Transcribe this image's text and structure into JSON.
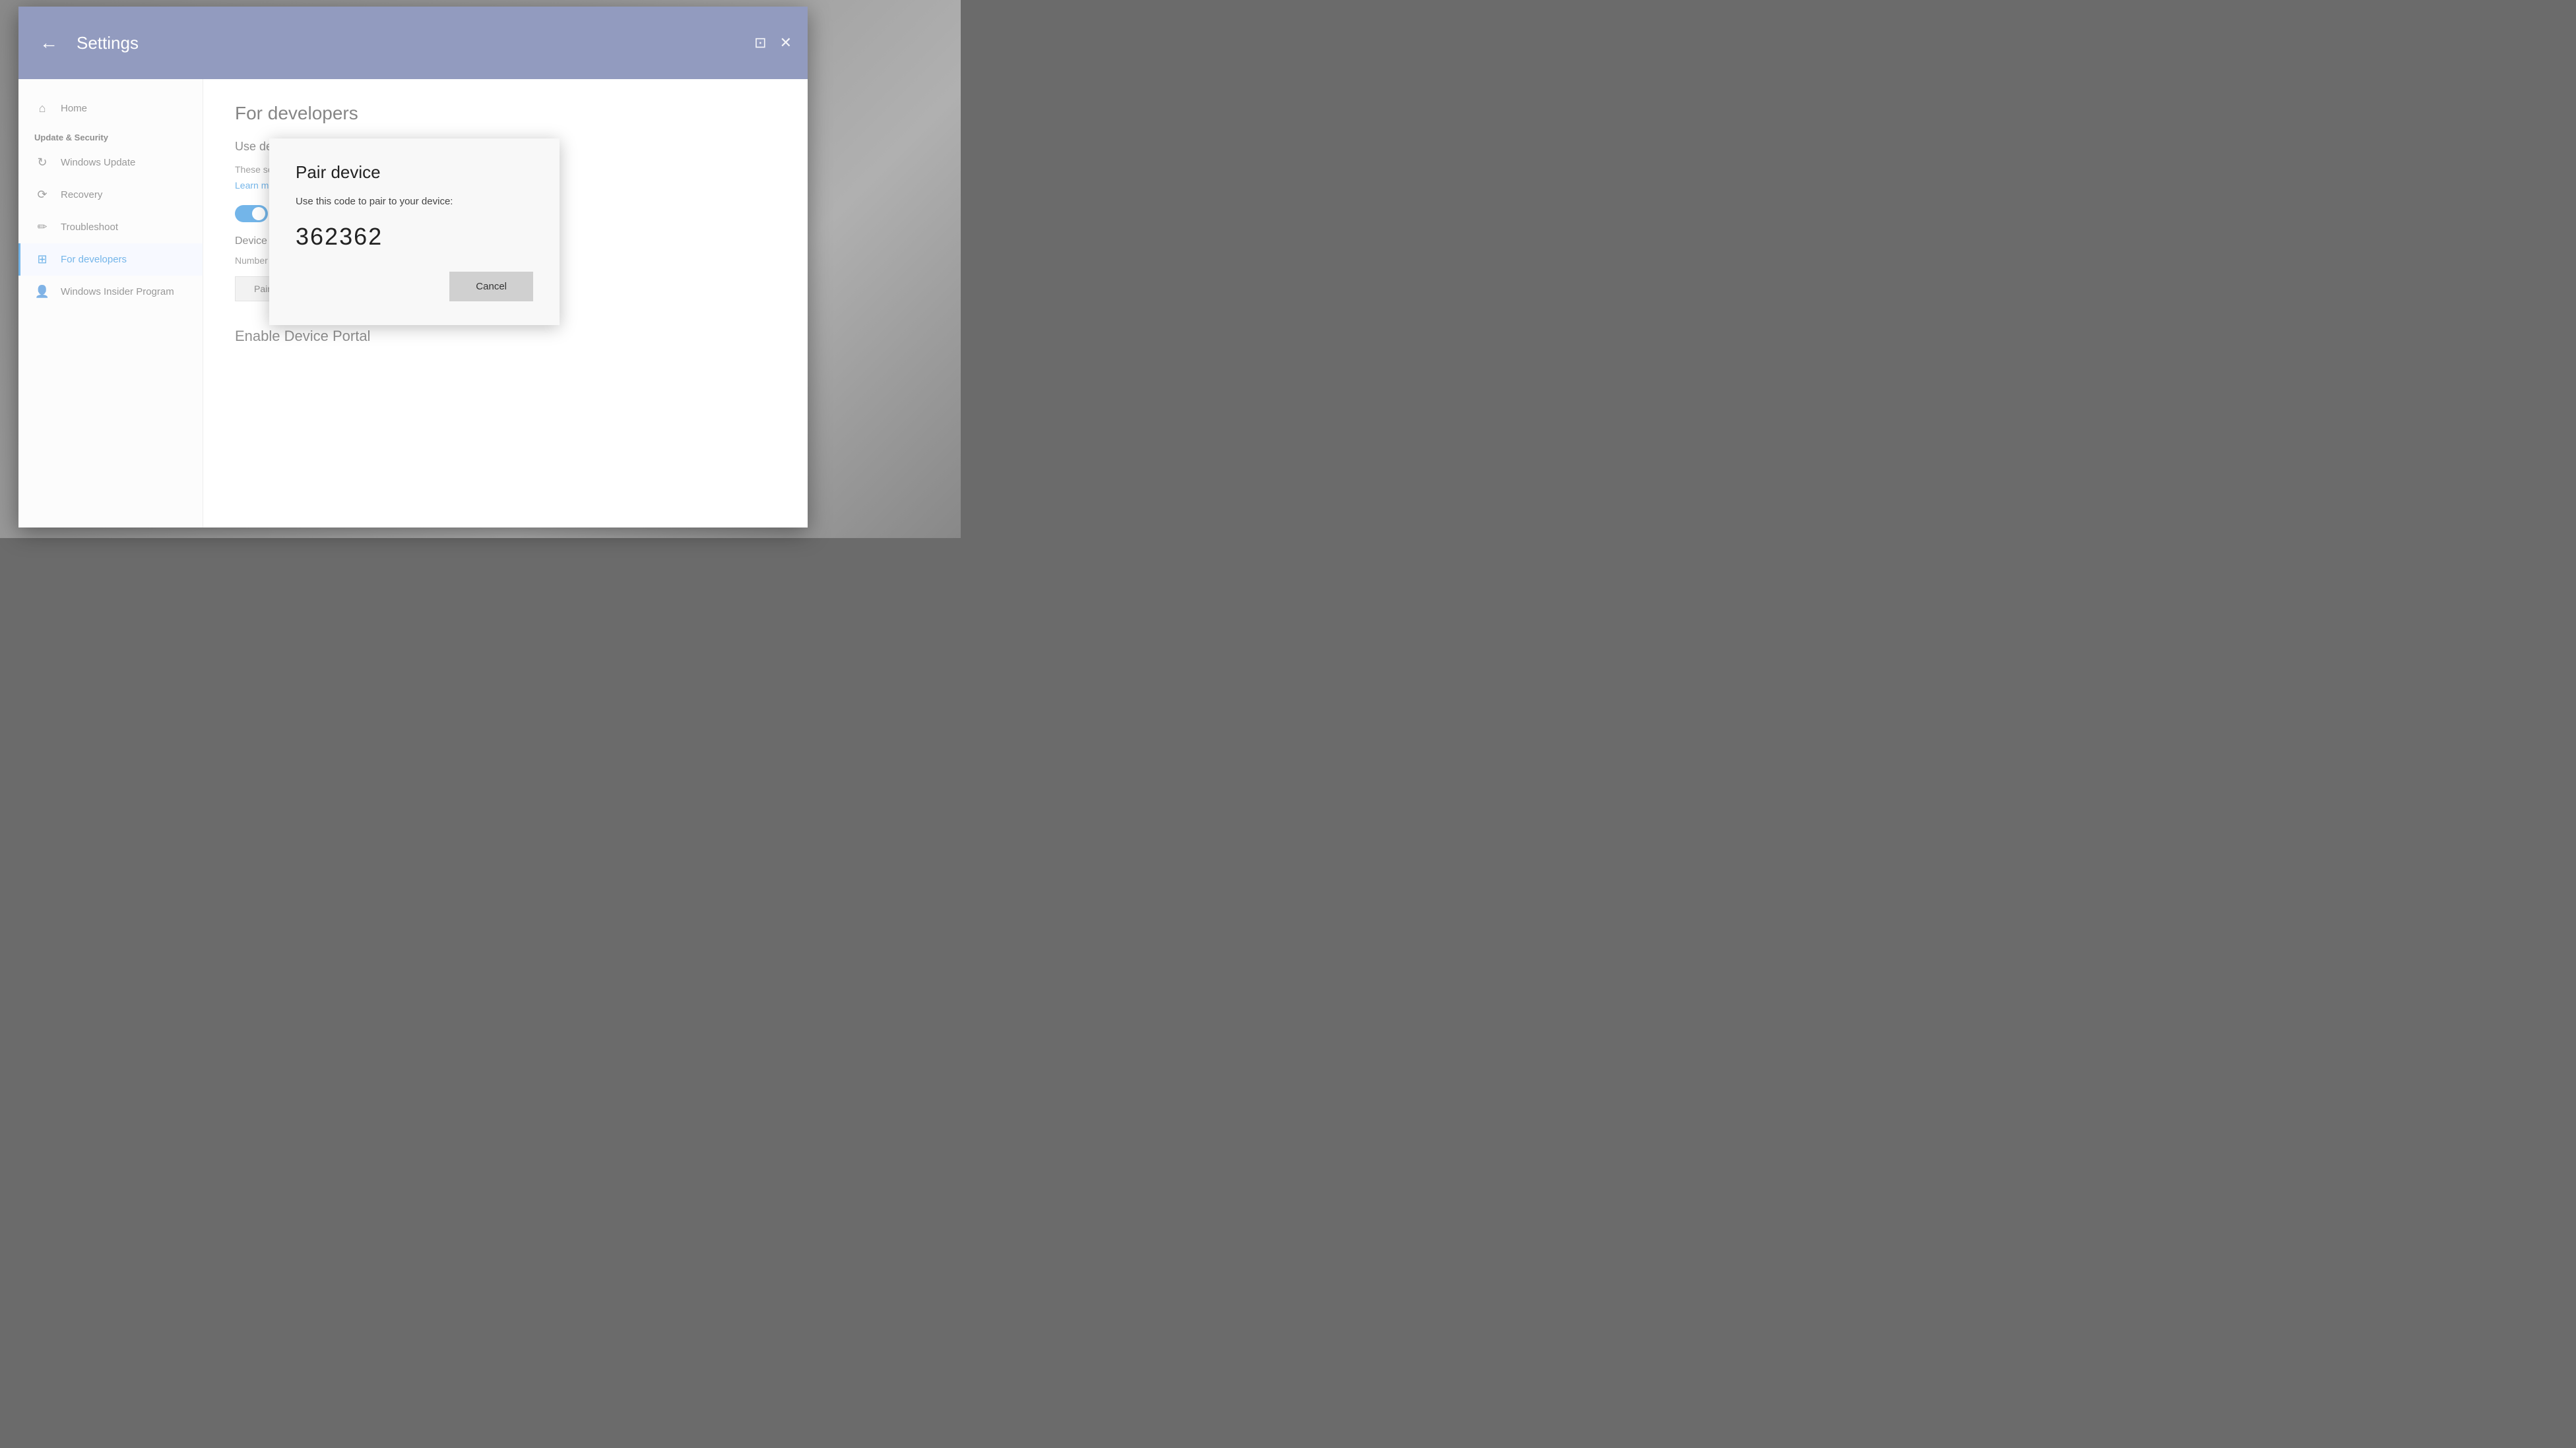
{
  "window": {
    "title": "Settings",
    "back_label": "←",
    "minimize_icon": "⊡",
    "close_icon": "✕"
  },
  "sidebar": {
    "home_label": "Home",
    "section_label": "Update & Security",
    "items": [
      {
        "id": "windows-update",
        "label": "Windows Update",
        "icon": "↻"
      },
      {
        "id": "recovery",
        "label": "Recovery",
        "icon": "⟳"
      },
      {
        "id": "troubleshoot",
        "label": "Troubleshoot",
        "icon": "✏"
      },
      {
        "id": "for-developers",
        "label": "For developers",
        "icon": "⊞",
        "active": true
      },
      {
        "id": "windows-insider",
        "label": "Windows Insider Program",
        "icon": "👤"
      }
    ]
  },
  "main": {
    "page_title": "For developers",
    "section_title": "Use developer features",
    "description": "These settings are intended for development use only.",
    "learn_more": "Learn more",
    "device_section_title": "Device discovery",
    "paired_devices_text": "Number of paired devices: 0",
    "pair_button_label": "Pair",
    "enable_device_portal_title": "Enable Device Portal"
  },
  "dialog": {
    "title": "Pair device",
    "description": "Use this code to pair to your device:",
    "code": "362362",
    "cancel_label": "Cancel"
  }
}
